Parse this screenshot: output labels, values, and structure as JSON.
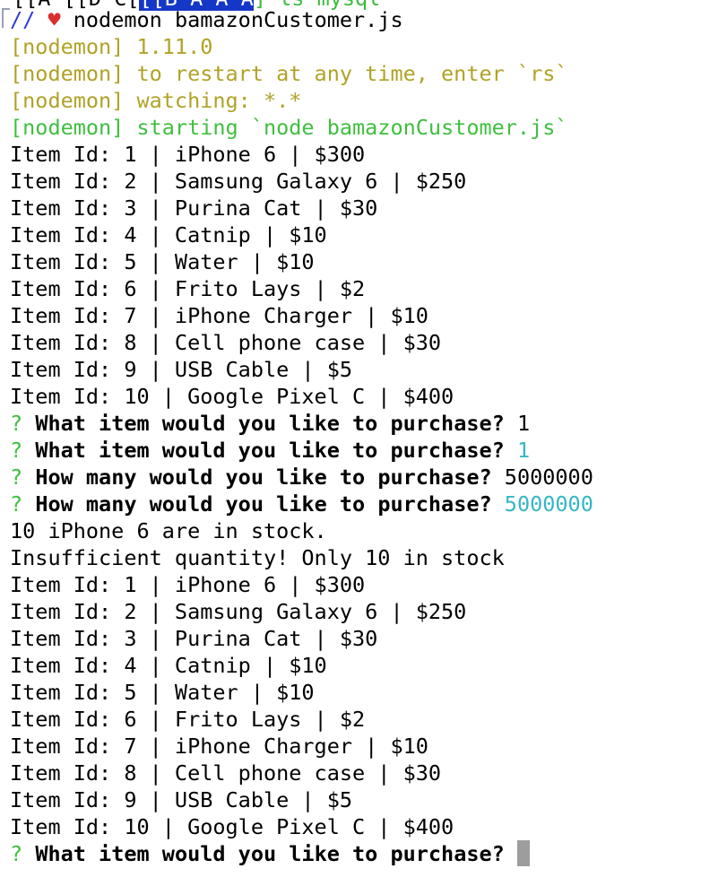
{
  "top_fragment": {
    "left": "[[A [[D C[",
    "selected": "[[B A A A",
    "right": "] ls mysql"
  },
  "prompt": {
    "slashes": "//",
    "heart": "♥",
    "command": " nodemon bamazonCustomer.js"
  },
  "nodemon": {
    "version": "[nodemon] 1.11.0",
    "restart": "[nodemon] to restart at any time, enter `rs`",
    "watching": "[nodemon] watching: *.*",
    "starting": "[nodemon] starting `node bamazonCustomer.js`"
  },
  "items_first": [
    "Item Id: 1 | iPhone 6 | $300",
    "Item Id: 2 | Samsung Galaxy 6 | $250",
    "Item Id: 3 | Purina Cat | $30",
    "Item Id: 4 | Catnip | $10",
    "Item Id: 5 | Water | $10",
    "Item Id: 6 | Frito Lays | $2",
    "Item Id: 7 | iPhone Charger | $10",
    "Item Id: 8 | Cell phone case | $30",
    "Item Id: 9 | USB Cable | $5",
    "Item Id: 10 | Google Pixel C | $400"
  ],
  "questions": {
    "marker": "?",
    "q_item": "What item would you like to purchase?",
    "q_item_typed": " 1",
    "q_item_answer": " 1",
    "q_qty": "How many would you like to purchase?",
    "q_qty_typed": " 5000000",
    "q_qty_answer": " 5000000"
  },
  "messages": {
    "stock": "10 iPhone 6 are in stock.",
    "insufficient": "Insufficient quantity! Only 10 in stock"
  },
  "items_second": [
    "Item Id: 1 | iPhone 6 | $300",
    "Item Id: 2 | Samsung Galaxy 6 | $250",
    "Item Id: 3 | Purina Cat | $30",
    "Item Id: 4 | Catnip | $10",
    "Item Id: 5 | Water | $10",
    "Item Id: 6 | Frito Lays | $2",
    "Item Id: 7 | iPhone Charger | $10",
    "Item Id: 8 | Cell phone case | $30",
    "Item Id: 9 | USB Cable | $5",
    "Item Id: 10 | Google Pixel C | $400"
  ],
  "colors": {
    "nodemon_yellow": "#b0a226",
    "nodemon_green": "#3fbf3f",
    "answer_cyan": "#35b7c4",
    "cursor_gray": "#9d9d9d"
  }
}
